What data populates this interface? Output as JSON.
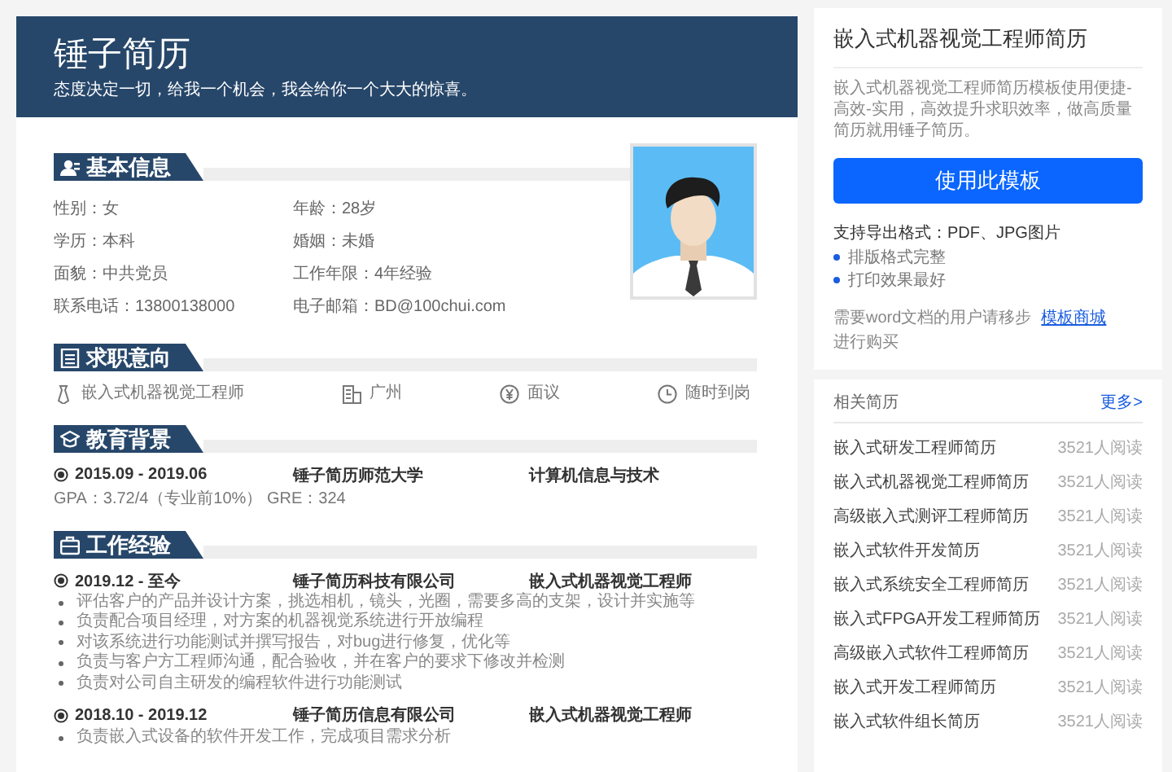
{
  "header": {
    "title": "锤子简历",
    "motto": "态度决定一切，给我一个机会，我会给你一个大大的惊喜。"
  },
  "basic_info": {
    "title": "基本信息",
    "fields": [
      "性别：女",
      "年龄：28岁",
      "学历：本科",
      "婚姻：未婚",
      "面貌：中共党员",
      "工作年限：4年经验",
      "联系电话：13800138000",
      "电子邮箱：BD@100chui.com"
    ]
  },
  "job_intent": {
    "title": "求职意向",
    "items": [
      "嵌入式机器视觉工程师",
      "广州",
      "面议",
      "随时到岗"
    ]
  },
  "education": {
    "title": "教育背景",
    "entries": [
      {
        "period": "2015.09 - 2019.06",
        "organization": "锤子简历师范大学",
        "role": "计算机信息与技术",
        "details": [
          "GPA：3.72/4（专业前10%） GRE：324"
        ]
      }
    ]
  },
  "work_experience": {
    "title": "工作经验",
    "entries": [
      {
        "period": "2019.12 - 至今",
        "organization": "锤子简历科技有限公司",
        "role": "嵌入式机器视觉工程师",
        "bullets": [
          "评估客户的产品并设计方案，挑选相机，镜头，光圈，需要多高的支架，设计并实施等",
          "负责配合项目经理，对方案的机器视觉系统进行开放编程",
          "对该系统进行功能测试并撰写报告，对bug进行修复，优化等",
          "负责与客户方工程师沟通，配合验收，并在客户的要求下修改并检测",
          "负责对公司自主研发的编程软件进行功能测试"
        ]
      },
      {
        "period": "2018.10 - 2019.12",
        "organization": "锤子简历信息有限公司",
        "role": "嵌入式机器视觉工程师",
        "bullets": [
          "负责嵌入式设备的软件开发工作，完成项目需求分析"
        ]
      }
    ]
  },
  "template": {
    "title": "嵌入式机器视觉工程师简历",
    "description": "嵌入式机器视觉工程师简历模板使用便捷-高效-实用，高效提升求职效率，做高质量简历就用锤子简历。",
    "button": "使用此模板",
    "formats": "支持导出格式：PDF、JPG图片",
    "features": [
      "排版格式完整",
      "打印效果最好"
    ],
    "word_note": {
      "before": "需要word文档的用户请移步",
      "link": "模板商城",
      "after": "进行购买"
    }
  },
  "related": {
    "title": "相关简历",
    "more": "更多>",
    "items": [
      {
        "name": "嵌入式研发工程师简历",
        "reads": "3521人阅读"
      },
      {
        "name": "嵌入式机器视觉工程师简历",
        "reads": "3521人阅读"
      },
      {
        "name": "高级嵌入式测评工程师简历",
        "reads": "3521人阅读"
      },
      {
        "name": "嵌入式软件开发简历",
        "reads": "3521人阅读"
      },
      {
        "name": "嵌入式系统安全工程师简历",
        "reads": "3521人阅读"
      },
      {
        "name": "嵌入式FPGA开发工程师简历",
        "reads": "3521人阅读"
      },
      {
        "name": "高级嵌入式软件工程师简历",
        "reads": "3521人阅读"
      },
      {
        "name": "嵌入式开发工程师简历",
        "reads": "3521人阅读"
      },
      {
        "name": "嵌入式软件组长简历",
        "reads": "3521人阅读"
      }
    ]
  }
}
